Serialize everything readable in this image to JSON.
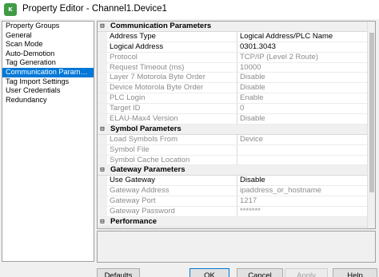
{
  "window": {
    "title": "Property Editor - Channel1.Device1",
    "icon_text": "K"
  },
  "tree": {
    "items": [
      {
        "label": "Property Groups",
        "selected": false
      },
      {
        "label": "General",
        "selected": false
      },
      {
        "label": "Scan Mode",
        "selected": false
      },
      {
        "label": "Auto-Demotion",
        "selected": false
      },
      {
        "label": "Tag Generation",
        "selected": false
      },
      {
        "label": "Communication Param…",
        "selected": true
      },
      {
        "label": "Tag Import Settings",
        "selected": false
      },
      {
        "label": "User Credentials",
        "selected": false
      },
      {
        "label": "Redundancy",
        "selected": false
      }
    ]
  },
  "grid": {
    "sections": [
      {
        "title": "Communication Parameters",
        "toggle": "⊟",
        "rows": [
          {
            "name": "Address Type",
            "value": "Logical Address/PLC Name",
            "disabled": false
          },
          {
            "name": "Logical Address",
            "value": "0301.3043",
            "disabled": false
          },
          {
            "name": "Protocol",
            "value": "TCP/IP (Level 2 Route)",
            "disabled": true
          },
          {
            "name": "Request Timeout (ms)",
            "value": "10000",
            "disabled": true
          },
          {
            "name": "Layer 7 Motorola Byte Order",
            "value": "Disable",
            "disabled": true
          },
          {
            "name": "Device Motorola Byte Order",
            "value": "Disable",
            "disabled": true
          },
          {
            "name": "PLC Login",
            "value": "Enable",
            "disabled": true
          },
          {
            "name": "Target ID",
            "value": "0",
            "disabled": true
          },
          {
            "name": "ELAU-Max4 Version",
            "value": "Disable",
            "disabled": true
          }
        ]
      },
      {
        "title": "Symbol Parameters",
        "toggle": "⊟",
        "rows": [
          {
            "name": "Load Symbols From",
            "value": "Device",
            "disabled": true
          },
          {
            "name": "Symbol File",
            "value": "",
            "disabled": true
          },
          {
            "name": "Symbol Cache Location",
            "value": "",
            "disabled": true
          }
        ]
      },
      {
        "title": "Gateway Parameters",
        "toggle": "⊟",
        "rows": [
          {
            "name": "Use Gateway",
            "value": "Disable",
            "disabled": false
          },
          {
            "name": "Gateway Address",
            "value": "ipaddress_or_hostname",
            "disabled": true
          },
          {
            "name": "Gateway Port",
            "value": "1217",
            "disabled": true
          },
          {
            "name": "Gateway Password",
            "value": "*******",
            "disabled": true
          }
        ]
      },
      {
        "title": "Performance",
        "toggle": "⊟",
        "rows": []
      }
    ]
  },
  "buttons": {
    "defaults": "Defaults",
    "ok": "OK",
    "cancel": "Cancel",
    "apply": "Apply",
    "help": "Help"
  }
}
